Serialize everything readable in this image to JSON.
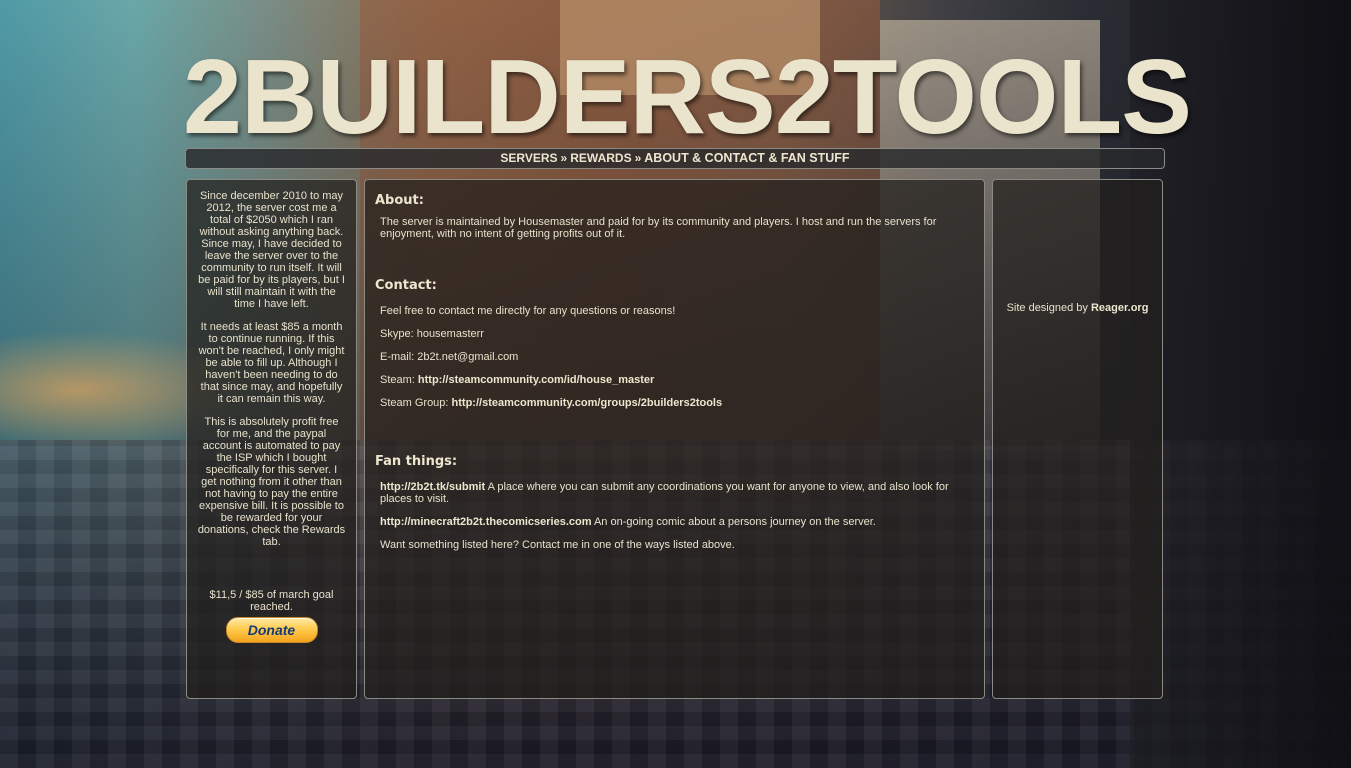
{
  "site": {
    "title": "2BUILDERS2TOOLS"
  },
  "nav": {
    "items": [
      {
        "label": "Servers"
      },
      {
        "label": "Rewards"
      },
      {
        "label": "ABOUT & CONTACT & FAN STUFF"
      }
    ],
    "separator": "»"
  },
  "sidebar": {
    "paragraphs": [
      "Since december 2010 to may 2012, the server cost me a total of $2050 which I ran without asking anything back. Since may, I have decided to leave the server over to the community to run itself. It will be paid for by its players, but I will still maintain it with the time I have left.",
      "It needs at least $85 a month to continue running. If this won't be reached, I only might be able to fill up. Although I haven't been needing to do that since may, and hopefully it can remain this way.",
      "This is absolutely profit free for me, and the paypal account is automated to pay the ISP which I bought specifically for this server. I get nothing from it other than not having to pay the entire expensive bill. It is possible to be rewarded for your donations, check the Rewards tab."
    ],
    "goal": "$11,5 / $85 of march goal reached.",
    "goal_progress": 0.135,
    "donate_label": "Donate"
  },
  "main": {
    "about": {
      "title": "About:",
      "text": "The server is maintained by Housemaster and paid for by its community and players. I host and run the servers for enjoyment, with no intent of getting profits out of it."
    },
    "contact": {
      "title": "Contact:",
      "intro": "Feel free to contact me directly for any questions or reasons!",
      "skype_label": "Skype:",
      "skype_value": "housemasterr",
      "email_label": "E-mail:",
      "email_value": "2b2t.net@gmail.com",
      "steam_label": "Steam:",
      "steam_link": "http://steamcommunity.com/id/house_master",
      "group_label": "Steam Group:",
      "group_link": "http://steamcommunity.com/groups/2builders2tools"
    },
    "fan": {
      "title": "Fan things:",
      "items": [
        {
          "link": "http://2b2t.tk/submit",
          "text": "A place where you can submit any coordinations you want for anyone to view, and also look for places to visit."
        },
        {
          "link": "http://minecraft2b2t.thecomicseries.com",
          "text": "An on-going comic about a persons journey on the server."
        }
      ],
      "footer": "Want something listed here? Contact me in one of the ways listed above."
    }
  },
  "right_panel": {
    "credit_prefix": "Site designed by",
    "credit_link": "Reager.org"
  },
  "colors": {
    "text": "#ece6ce",
    "panel_border": "#8c8a84",
    "donate_button": "#ffcc4d"
  }
}
